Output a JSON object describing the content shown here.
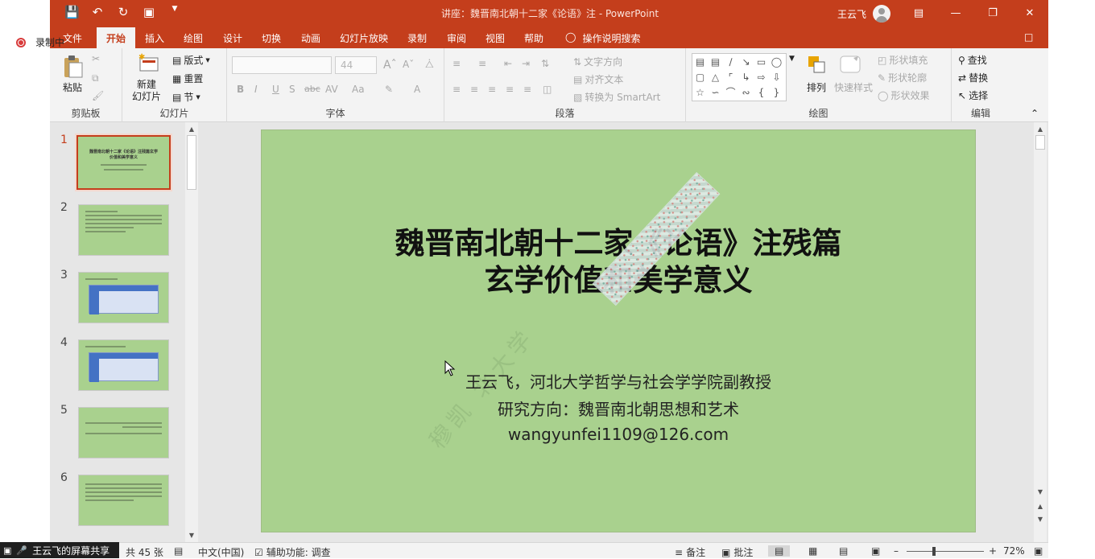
{
  "recording": {
    "label": "录制中"
  },
  "window": {
    "title": "讲座：魏晋南北朝十二家《论语》注 - PowerPoint",
    "user": "王云飞",
    "qat": [
      "save-icon",
      "undo-icon",
      "redo-icon",
      "slideshow-icon",
      "customize-icon"
    ],
    "controls": [
      "ribbon-display-icon",
      "minimize-icon",
      "restore-icon",
      "close-icon"
    ]
  },
  "tabs": [
    {
      "label": "文件",
      "active": false
    },
    {
      "label": "开始",
      "active": true
    },
    {
      "label": "插入",
      "active": false
    },
    {
      "label": "绘图",
      "active": false
    },
    {
      "label": "设计",
      "active": false
    },
    {
      "label": "切换",
      "active": false
    },
    {
      "label": "动画",
      "active": false
    },
    {
      "label": "幻灯片放映",
      "active": false
    },
    {
      "label": "录制",
      "active": false
    },
    {
      "label": "审阅",
      "active": false
    },
    {
      "label": "视图",
      "active": false
    },
    {
      "label": "帮助",
      "active": false
    }
  ],
  "tell_me": "操作说明搜索",
  "ribbon": {
    "clipboard": {
      "label": "剪贴板",
      "paste": "粘贴"
    },
    "slides": {
      "label": "幻灯片",
      "new_slide": "新建\n幻灯片",
      "layout": "版式",
      "reset": "重置",
      "section": "节"
    },
    "font": {
      "label": "字体",
      "size": "44",
      "buttons": [
        "B",
        "I",
        "U",
        "S",
        "abc",
        "AV",
        "Aa",
        "A"
      ]
    },
    "paragraph": {
      "label": "段落",
      "text_direction": "文字方向",
      "align_text": "对齐文本",
      "smartart": "转换为 SmartArt"
    },
    "drawing": {
      "label": "绘图",
      "arrange": "排列",
      "quick_styles": "快速样式",
      "shape_fill": "形状填充",
      "shape_outline": "形状轮廓",
      "shape_effects": "形状效果"
    },
    "editing": {
      "label": "编辑",
      "find": "查找",
      "replace": "替换",
      "select": "选择"
    }
  },
  "thumbnails": [
    {
      "num": "1",
      "selected": true,
      "text": "魏晋南北朝十二家《论语》注残篇玄学价值和美学意义"
    },
    {
      "num": "2",
      "selected": false,
      "text": ""
    },
    {
      "num": "3",
      "selected": false,
      "text": ""
    },
    {
      "num": "4",
      "selected": false,
      "text": ""
    },
    {
      "num": "5",
      "selected": false,
      "text": ""
    },
    {
      "num": "6",
      "selected": false,
      "text": ""
    }
  ],
  "slide": {
    "title_line1": "魏晋南北朝十二家《论语》注残篇",
    "title_line2": "玄学价值和美学意义",
    "author": "王云飞，河北大学哲学与社会学学院副教授",
    "research": "研究方向：魏晋南北朝思想和艺术",
    "email": "wangyunfei1109@126.com",
    "watermark": "穆凯 北大学"
  },
  "status": {
    "share": "王云飞的屏幕共享",
    "slide_count": "共 45 张",
    "language": "中文(中国)",
    "accessibility": "辅助功能: 调查",
    "notes": "备注",
    "comments": "批注",
    "zoom": "72%"
  }
}
